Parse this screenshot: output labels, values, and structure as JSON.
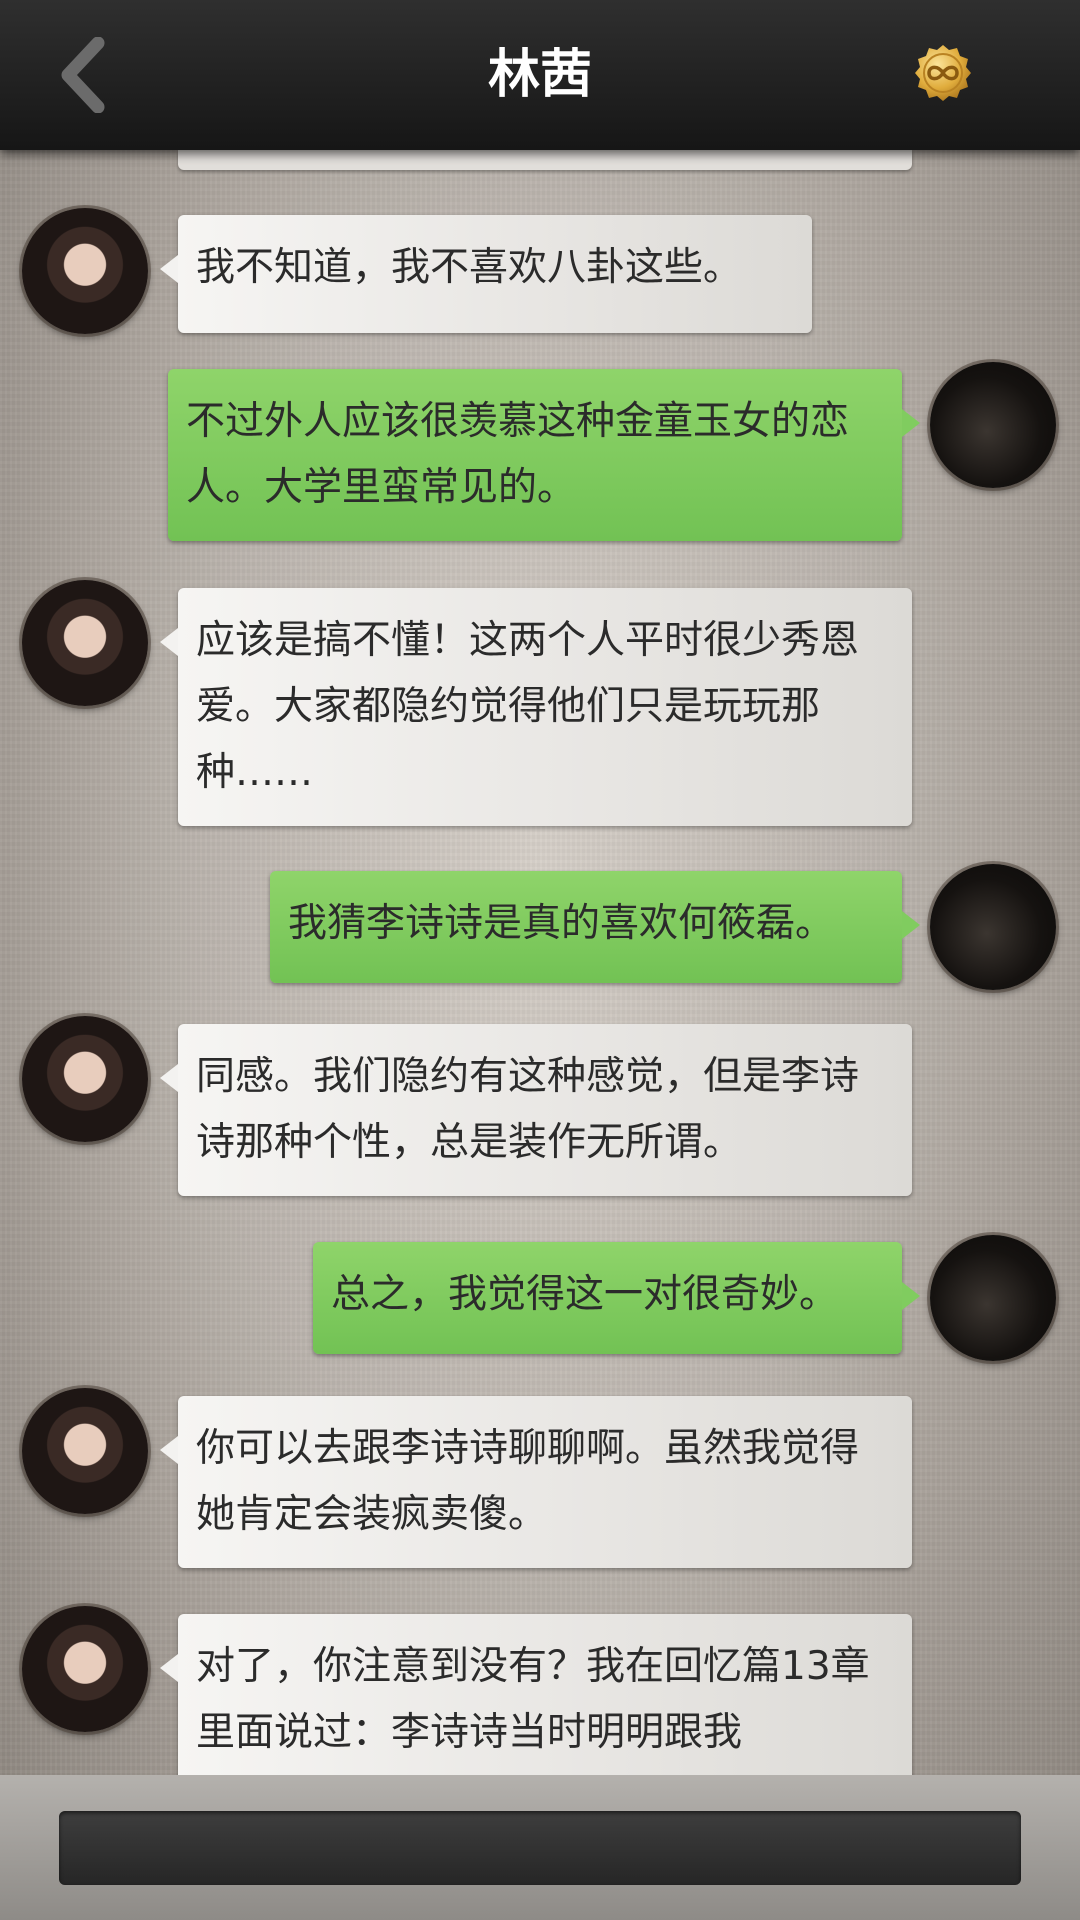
{
  "header": {
    "title": "林茜"
  },
  "messages": [
    {
      "side": "in",
      "text": "我不知道，我不喜欢八卦这些。"
    },
    {
      "side": "out",
      "text": "不过外人应该很羡慕这种金童玉女的恋人。大学里蛮常见的。"
    },
    {
      "side": "in",
      "text": "应该是搞不懂！这两个人平时很少秀恩爱。大家都隐约觉得他们只是玩玩那种……"
    },
    {
      "side": "out",
      "text": "我猜李诗诗是真的喜欢何筱磊。"
    },
    {
      "side": "in",
      "text": "同感。我们隐约有这种感觉，但是李诗诗那种个性，总是装作无所谓。"
    },
    {
      "side": "out",
      "text": "总之，我觉得这一对很奇妙。"
    },
    {
      "side": "in",
      "text": "你可以去跟李诗诗聊聊啊。虽然我觉得她肯定会装疯卖傻。"
    },
    {
      "side": "in",
      "text": "对了，你注意到没有？我在回忆篇13章里面说过：李诗诗当时明明跟我"
    }
  ],
  "icons": {
    "back": "chevron-left-icon",
    "coin": "infinity-coin-icon"
  },
  "colors": {
    "header": "#1f1f1f",
    "bubble_in": "#ecebe8",
    "bubble_out": "#7fcb5e",
    "text": "#2b2b2b",
    "coin": "#e5b84a"
  }
}
